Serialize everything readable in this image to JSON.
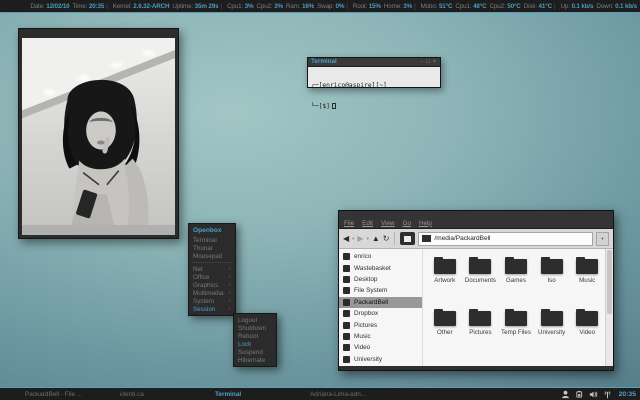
{
  "colors": {
    "accent_blue": "#4fa0c6",
    "panel_bg": "#1d1d1d",
    "panel_edge_blue": "#5e9cb4",
    "menu_bg": "#2b2b2b",
    "desktop_teal": "#8db5b7",
    "selected_row_gray": "#989898"
  },
  "top_bar": {
    "separator": "|",
    "groups": [
      [
        {
          "label": "Date:",
          "value": "12/02/10"
        },
        {
          "label": "Time:",
          "value": "20:35"
        }
      ],
      [
        {
          "label": "Kernel:",
          "value": "2.6.32-ARCH"
        },
        {
          "label": "Uptime:",
          "value": "35m 29s"
        }
      ],
      [
        {
          "label": "Cpu1:",
          "value": "3%"
        },
        {
          "label": "Cpu2:",
          "value": "3%"
        },
        {
          "label": "Ram:",
          "value": "16%"
        },
        {
          "label": "Swap:",
          "value": "0%"
        }
      ],
      [
        {
          "label": "Root:",
          "value": "15%"
        },
        {
          "label": "Home:",
          "value": "3%"
        }
      ],
      [
        {
          "label": "Mobo:",
          "value": "51°C"
        },
        {
          "label": "Cpu1:",
          "value": "48°C"
        },
        {
          "label": "Cpu2:",
          "value": "50°C"
        },
        {
          "label": "Disk:",
          "value": "41°C"
        }
      ],
      [
        {
          "label": "Up:",
          "value": "0.1 kb/s"
        },
        {
          "label": "Down:",
          "value": "0.1 kb/s"
        }
      ]
    ]
  },
  "terminal": {
    "title": "Terminal",
    "buttons": "- □ ×",
    "line1": "┌─[enrico@aspire][~]",
    "line2": "└─[$]"
  },
  "openbox_menu": {
    "header": "Openbox",
    "arrow": "»",
    "items": [
      {
        "label": "Terminal"
      },
      {
        "label": "Thunar"
      },
      {
        "label": "Mousepad"
      },
      {
        "separator": true
      },
      {
        "label": "Net",
        "submenu": true
      },
      {
        "label": "Office",
        "submenu": true
      },
      {
        "label": "Graphics",
        "submenu": true
      },
      {
        "label": "Multimedia",
        "submenu": true
      },
      {
        "label": "System",
        "submenu": true
      },
      {
        "label": "Session",
        "submenu": true,
        "selected": true
      }
    ],
    "submenu": [
      {
        "label": "Logout"
      },
      {
        "label": "Shutdown"
      },
      {
        "label": "Reboot"
      },
      {
        "label": "Lock",
        "selected": true
      },
      {
        "label": "Suspend"
      },
      {
        "label": "Hibernate"
      }
    ]
  },
  "file_manager": {
    "menus": [
      "File",
      "Edit",
      "View",
      "Go",
      "Help"
    ],
    "toolbar": {
      "back_glyph": "◀",
      "forward_glyph": "▶",
      "up_glyph": "▲",
      "reload_glyph": "↻",
      "caret_glyph": "▾",
      "dropdown_glyph": "▾",
      "path": "/media/PackardBell"
    },
    "sidebar": [
      {
        "label": "enrico",
        "icon": "home-folder-icon"
      },
      {
        "label": "Wastebasket",
        "icon": "trash-icon"
      },
      {
        "label": "Desktop",
        "icon": "desktop-icon"
      },
      {
        "label": "File System",
        "icon": "filesystem-icon"
      },
      {
        "label": "PackardBell",
        "icon": "drive-icon",
        "selected": true
      },
      {
        "label": "Dropbox",
        "icon": "folder-icon"
      },
      {
        "label": "Pictures",
        "icon": "folder-icon"
      },
      {
        "label": "Music",
        "icon": "folder-icon"
      },
      {
        "label": "Video",
        "icon": "folder-icon"
      },
      {
        "label": "University",
        "icon": "folder-icon"
      }
    ],
    "folders": [
      "Artwork",
      "Documents",
      "Games",
      "Iso",
      "Music",
      "Other",
      "Pictures",
      "Temp Files",
      "University",
      "Video"
    ]
  },
  "taskbar": {
    "items": [
      {
        "label": "PackardBell - File ...",
        "active": false
      },
      {
        "label": "identi.ca",
        "active": false
      },
      {
        "label": "Terminal",
        "active": true
      },
      {
        "label": "Adriana-Lima-adri...",
        "active": false
      }
    ],
    "tray_icons": [
      "user-icon",
      "battery-icon",
      "volume-icon",
      "network-icon"
    ],
    "clock": "20:35"
  }
}
